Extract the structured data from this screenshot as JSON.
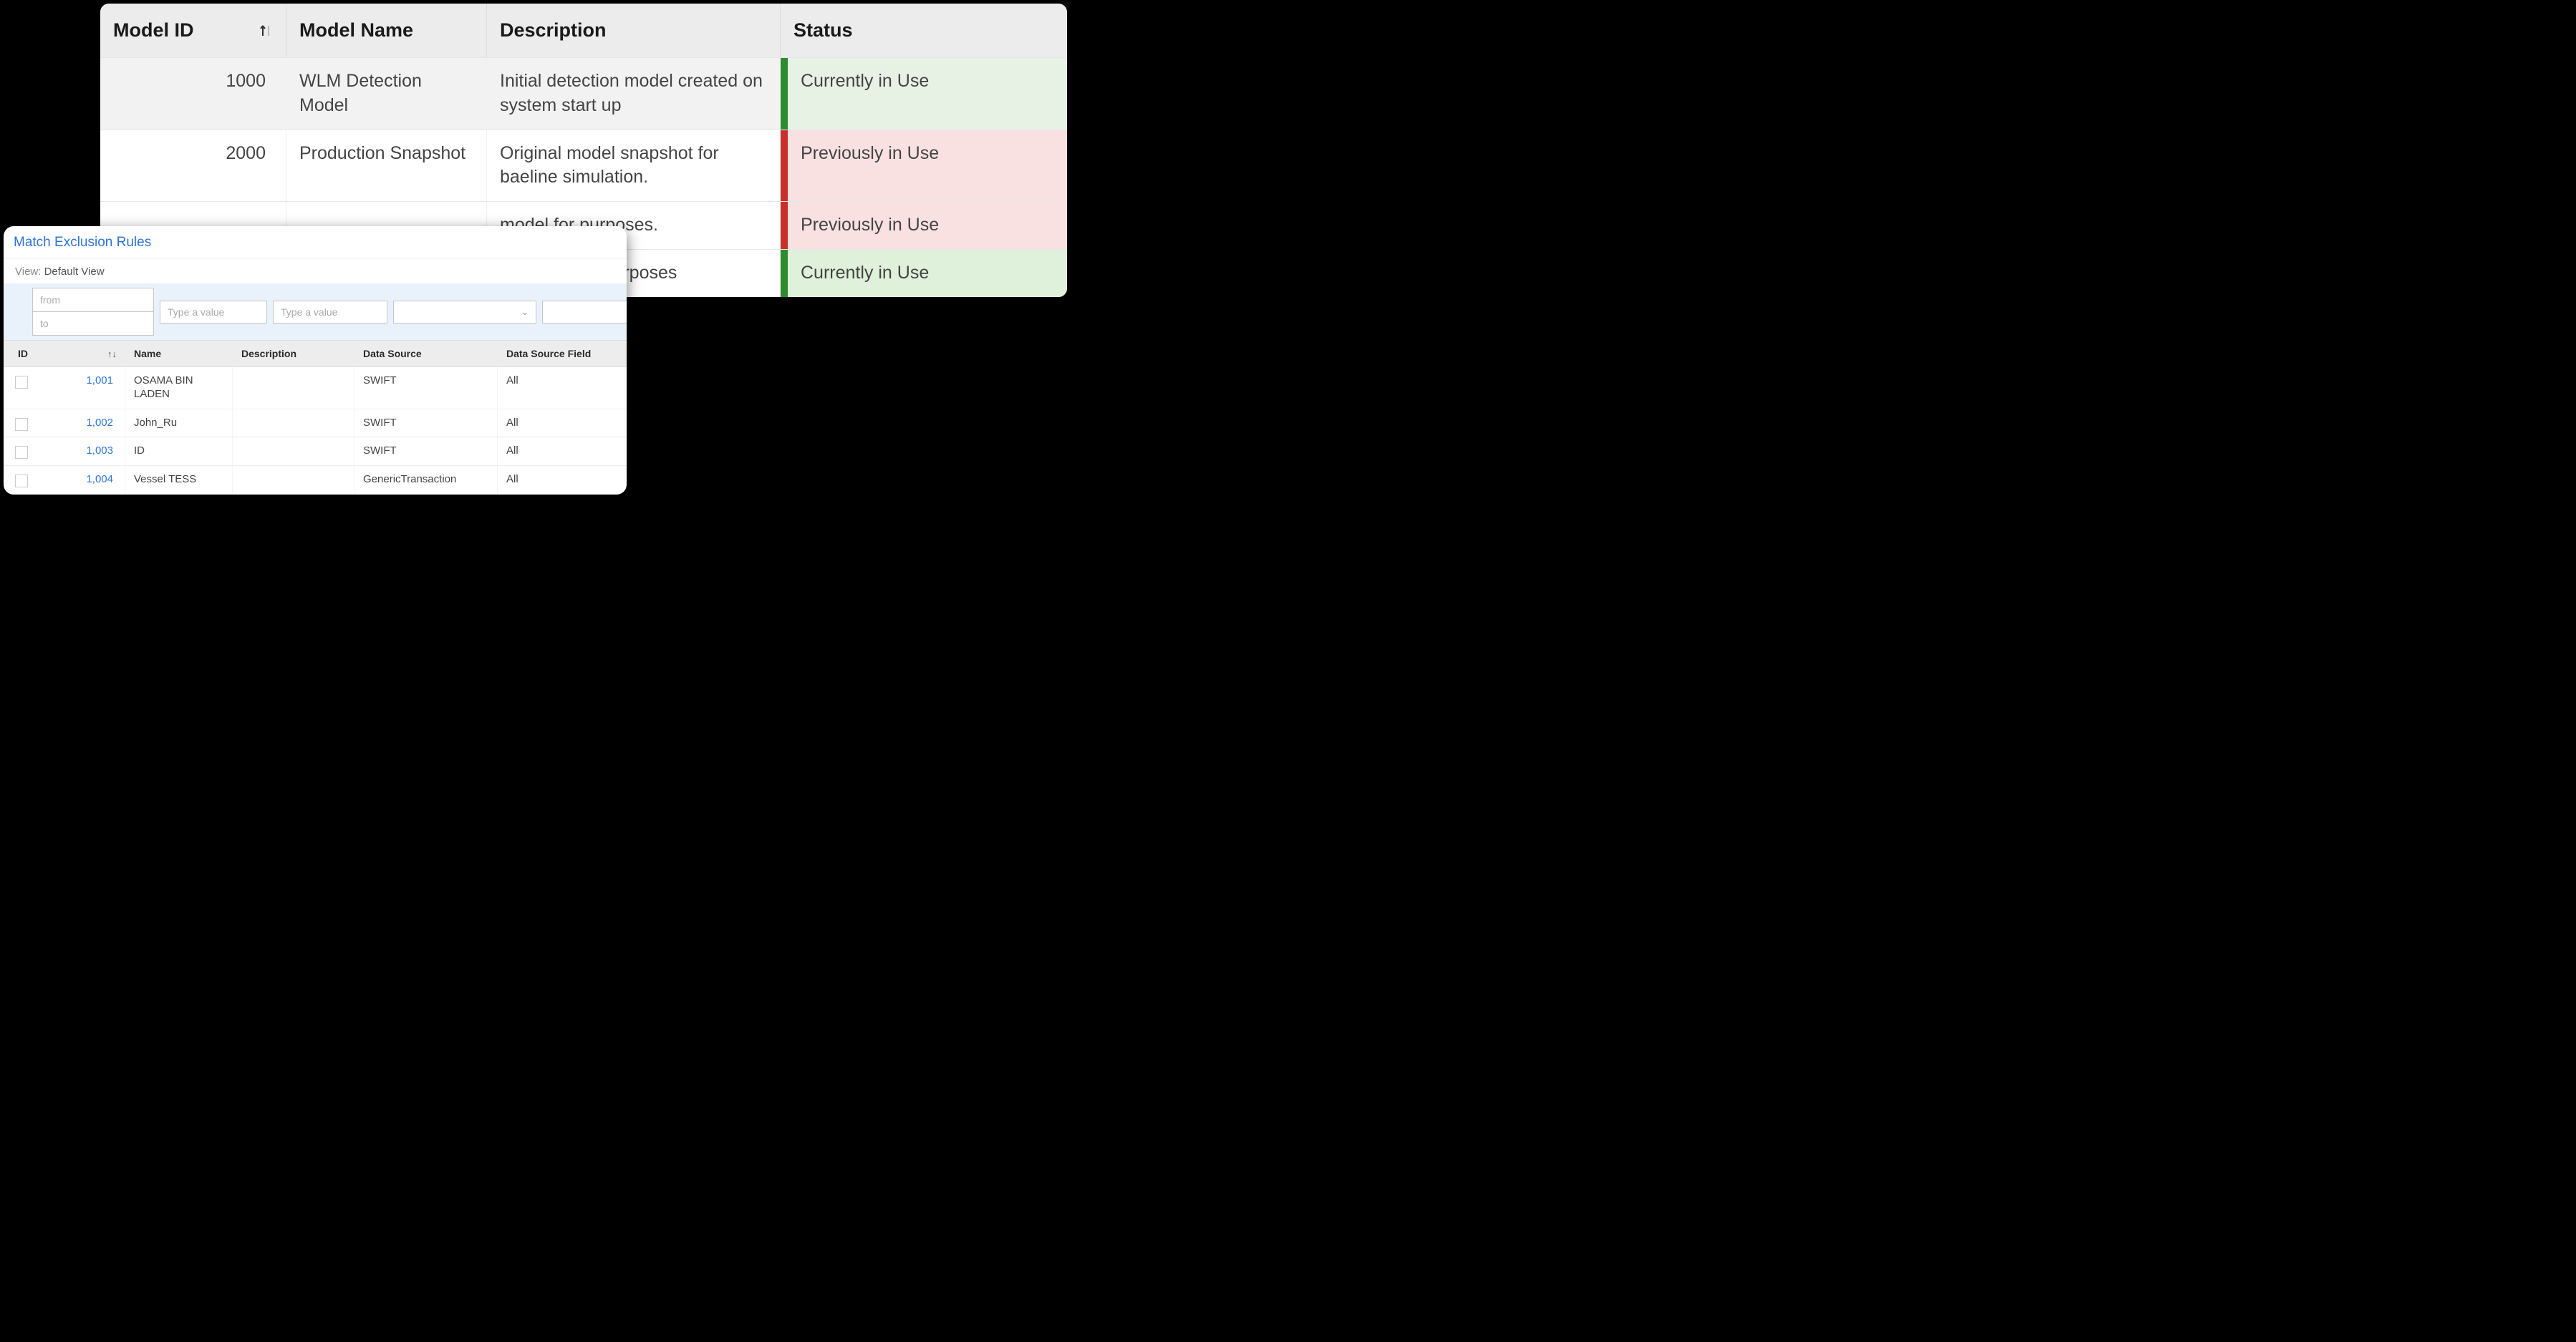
{
  "models": {
    "headers": {
      "id": "Model ID",
      "name": "Model Name",
      "desc": "Description",
      "status": "Status"
    },
    "rows": [
      {
        "id": "1000",
        "name": "WLM Detection Model",
        "desc": "Initial detection model created on system start up",
        "status": "Currently in Use",
        "status_class": "green-light",
        "selected": true
      },
      {
        "id": "2000",
        "name": "Production Snapshot",
        "desc": "Original model snapshot for baeline simulation.",
        "status": "Previously in Use",
        "status_class": "red",
        "selected": false
      },
      {
        "id": "",
        "name": "",
        "desc": "model for purposes.",
        "status": "Previously in Use",
        "status_class": "red",
        "selected": false
      },
      {
        "id": "",
        "name": "",
        "desc": "snapshot for purposes",
        "status": "Currently in Use",
        "status_class": "green-lighter",
        "selected": false
      }
    ]
  },
  "rules": {
    "title": "Match Exclusion Rules",
    "view_label": "View:",
    "view_value": "Default View",
    "filters": {
      "from": "from",
      "to": "to",
      "type_value": "Type a value"
    },
    "headers": {
      "id": "ID",
      "name": "Name",
      "desc": "Description",
      "ds": "Data Source",
      "dsf": "Data Source Field"
    },
    "rows": [
      {
        "id": "1,001",
        "name": "OSAMA BIN LADEN",
        "desc": "",
        "ds": "SWIFT",
        "dsf": "All"
      },
      {
        "id": "1,002",
        "name": "John_Ru",
        "desc": "",
        "ds": "SWIFT",
        "dsf": "All"
      },
      {
        "id": "1,003",
        "name": "ID",
        "desc": "",
        "ds": "SWIFT",
        "dsf": "All"
      },
      {
        "id": "1,004",
        "name": "Vessel TESS",
        "desc": "",
        "ds": "GenericTransaction",
        "dsf": "All"
      }
    ]
  }
}
